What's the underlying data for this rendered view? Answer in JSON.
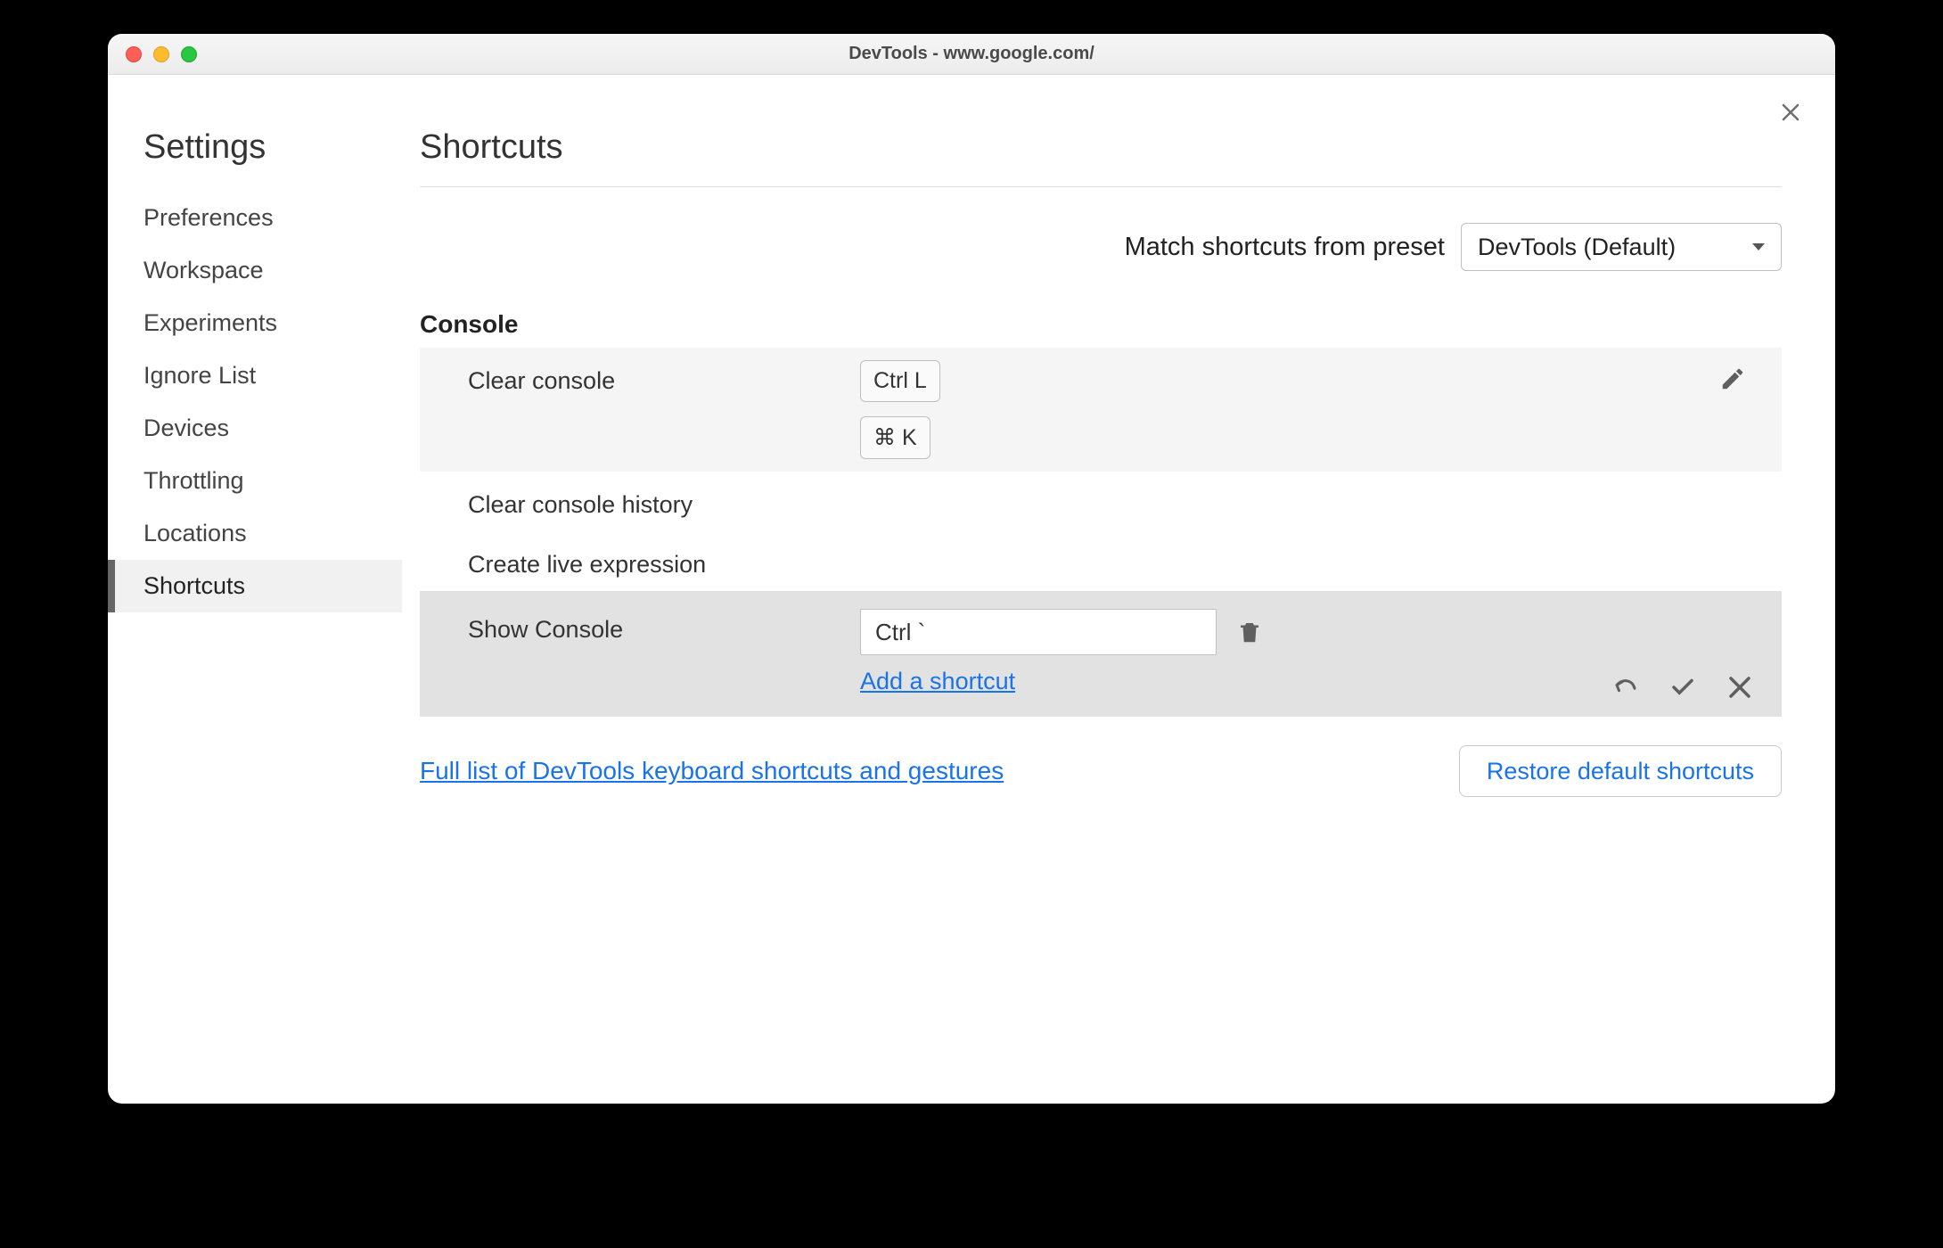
{
  "window": {
    "title": "DevTools - www.google.com/"
  },
  "sidebar": {
    "title": "Settings",
    "items": [
      {
        "label": "Preferences"
      },
      {
        "label": "Workspace"
      },
      {
        "label": "Experiments"
      },
      {
        "label": "Ignore List"
      },
      {
        "label": "Devices"
      },
      {
        "label": "Throttling"
      },
      {
        "label": "Locations"
      },
      {
        "label": "Shortcuts"
      }
    ]
  },
  "main": {
    "title": "Shortcuts",
    "preset_label": "Match shortcuts from preset",
    "preset_value": "DevTools (Default)",
    "section": "Console",
    "rows": {
      "clear_console": {
        "label": "Clear console",
        "key1": "Ctrl L",
        "key2": "⌘ K"
      },
      "clear_history": {
        "label": "Clear console history"
      },
      "create_live": {
        "label": "Create live expression"
      },
      "show_console": {
        "label": "Show Console",
        "input_value": "Ctrl `",
        "add_link": "Add a shortcut"
      }
    },
    "footer_link": "Full list of DevTools keyboard shortcuts and gestures",
    "restore_button": "Restore default shortcuts"
  }
}
